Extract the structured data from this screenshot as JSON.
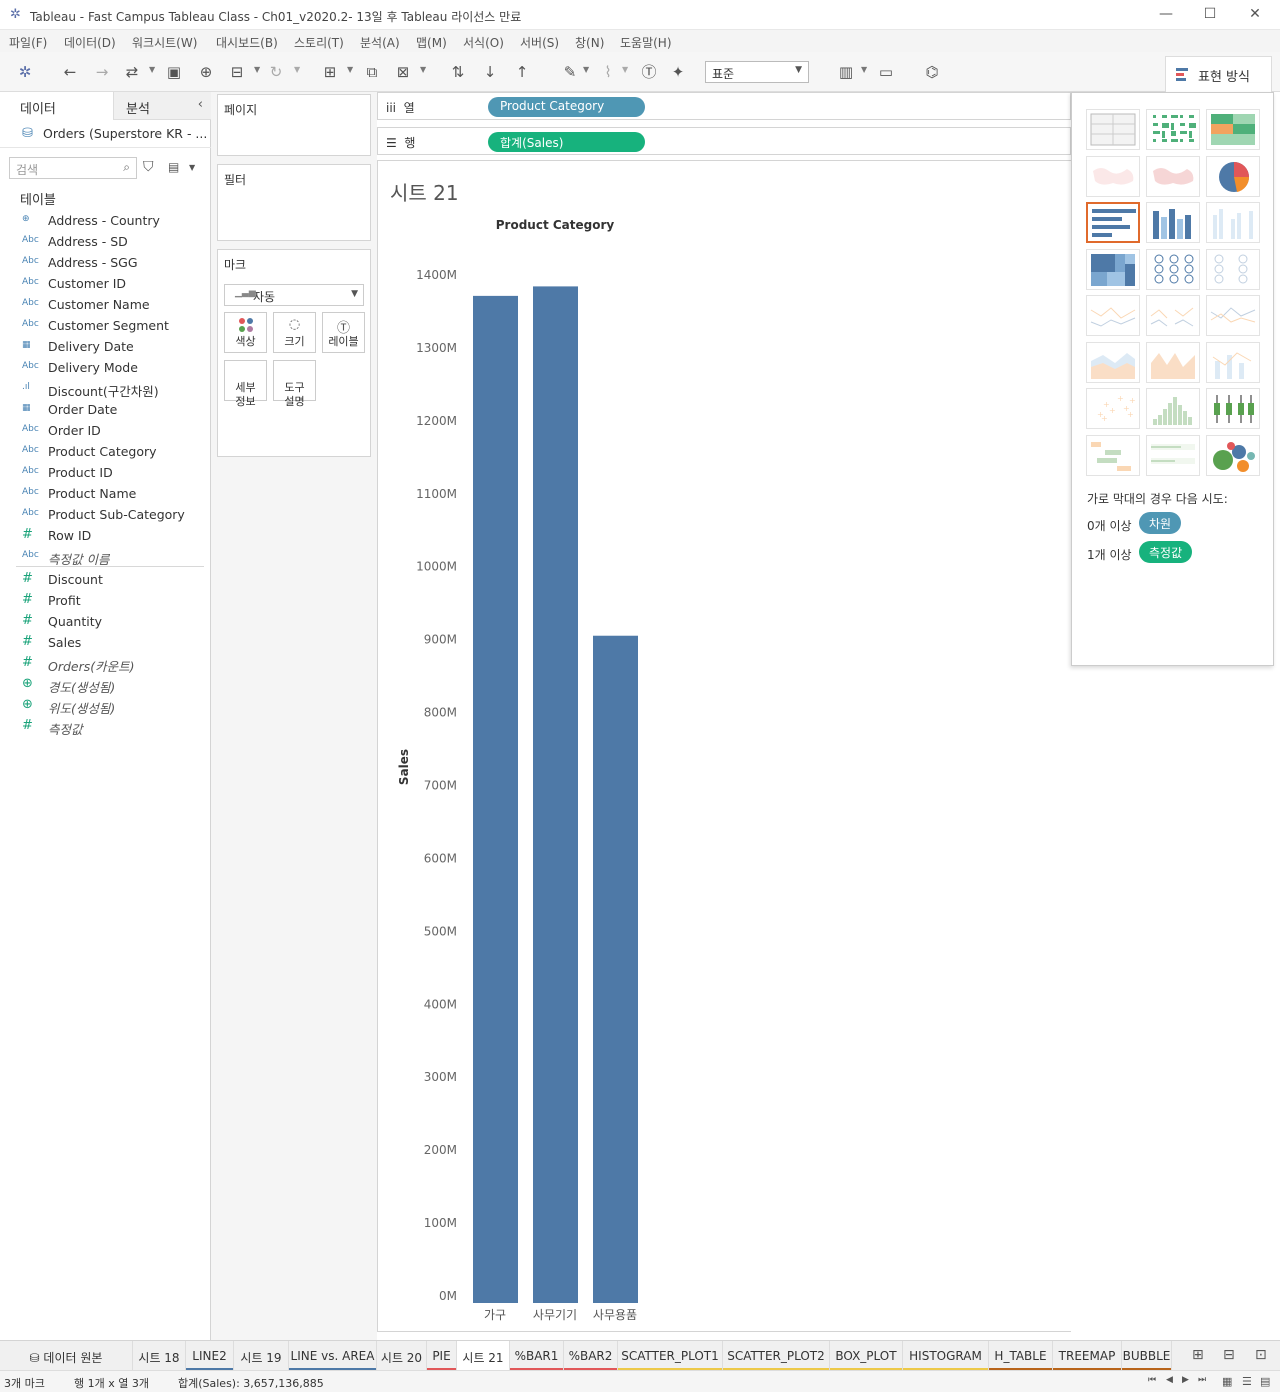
{
  "window": {
    "title": "Tableau - Fast Campus Tableau Class - Ch01_v2020.2- 13일 후 Tableau 라이선스 만료"
  },
  "menu": [
    "파일(F)",
    "데이터(D)",
    "워크시트(W)",
    "대시보드(B)",
    "스토리(T)",
    "분석(A)",
    "맵(M)",
    "서식(O)",
    "서버(S)",
    "창(N)",
    "도움말(H)"
  ],
  "toolbar": {
    "zoom_value": "표준",
    "show_me_label": "표현 방식"
  },
  "left_pane": {
    "tab_data": "데이터",
    "tab_analysis": "분석",
    "datasource": "Orders (Superstore KR - ...",
    "search_placeholder": "검색",
    "tables_header": "테이블",
    "dimensions": [
      {
        "icon": "globe",
        "name": "Address - Country"
      },
      {
        "icon": "Abc",
        "name": "Address - SD"
      },
      {
        "icon": "Abc",
        "name": "Address - SGG"
      },
      {
        "icon": "Abc",
        "name": "Customer ID"
      },
      {
        "icon": "Abc",
        "name": "Customer Name"
      },
      {
        "icon": "Abc",
        "name": "Customer Segment"
      },
      {
        "icon": "calendar",
        "name": "Delivery Date"
      },
      {
        "icon": "Abc",
        "name": "Delivery Mode"
      },
      {
        "icon": "bins",
        "name": "Discount(구간차원)"
      },
      {
        "icon": "calendar",
        "name": "Order Date"
      },
      {
        "icon": "Abc",
        "name": "Order ID"
      },
      {
        "icon": "Abc",
        "name": "Product Category"
      },
      {
        "icon": "Abc",
        "name": "Product ID"
      },
      {
        "icon": "Abc",
        "name": "Product Name"
      },
      {
        "icon": "Abc",
        "name": "Product Sub-Category"
      },
      {
        "icon": "#",
        "name": "Row ID"
      },
      {
        "icon": "Abc",
        "name": "측정값 이름",
        "italic": true
      }
    ],
    "measures": [
      {
        "icon": "#",
        "name": "Discount"
      },
      {
        "icon": "#",
        "name": "Profit"
      },
      {
        "icon": "#",
        "name": "Quantity"
      },
      {
        "icon": "#",
        "name": "Sales"
      },
      {
        "icon": "#",
        "name": "Orders(카운트)",
        "italic": true
      },
      {
        "icon": "globe",
        "name": "경도(생성됨)",
        "italic": true
      },
      {
        "icon": "globe",
        "name": "위도(생성됨)",
        "italic": true
      },
      {
        "icon": "#",
        "name": "측정값",
        "italic": true
      }
    ]
  },
  "cards": {
    "pages": "페이지",
    "filters": "필터",
    "marks": "마크",
    "mark_type": "자동",
    "mark_buttons": {
      "color": "색상",
      "size": "크기",
      "label": "레이블",
      "detail": "세부\n정보",
      "tooltip": "도구\n설명"
    }
  },
  "shelves": {
    "columns_label": "열",
    "rows_label": "행",
    "columns_pill": "Product Category",
    "rows_pill": "합계(Sales)"
  },
  "sheet": {
    "title": "시트 21"
  },
  "chart_data": {
    "type": "bar",
    "title": "Product Category",
    "ylabel": "Sales",
    "categories": [
      "가구",
      "사무기기",
      "사무용품"
    ],
    "values": [
      1370,
      1383,
      904
    ],
    "unit_suffix": "M",
    "ylim": [
      0,
      1400
    ],
    "yticks": [
      0,
      100,
      200,
      300,
      400,
      500,
      600,
      700,
      800,
      900,
      1000,
      1100,
      1200,
      1300,
      1400
    ],
    "bar_color": "#4e79a7"
  },
  "show_me": {
    "hint": "가로 막대의 경우 다음 시도:",
    "dim_count": "0개 이상",
    "dim_badge": "차원",
    "meas_count": "1개 이상",
    "meas_badge": "측정값"
  },
  "sheet_tabs": [
    {
      "label": "데이터 원본",
      "color": ""
    },
    {
      "label": "시트 18",
      "color": ""
    },
    {
      "label": "LINE2",
      "color": "#4e79a7"
    },
    {
      "label": "시트 19",
      "color": ""
    },
    {
      "label": "LINE vs. AREA",
      "color": "#4e79a7"
    },
    {
      "label": "시트 20",
      "color": ""
    },
    {
      "label": "PIE",
      "color": "#e15759"
    },
    {
      "label": "시트 21",
      "color": "",
      "active": true
    },
    {
      "label": "%BAR1",
      "color": "#e15759"
    },
    {
      "label": "%BAR2",
      "color": "#e15759"
    },
    {
      "label": "SCATTER_PLOT1",
      "color": "#edc948"
    },
    {
      "label": "SCATTER_PLOT2",
      "color": "#edc948"
    },
    {
      "label": "BOX_PLOT",
      "color": "#edc948"
    },
    {
      "label": "HISTOGRAM",
      "color": "#edc948"
    },
    {
      "label": "H_TABLE",
      "color": "#b8641a"
    },
    {
      "label": "TREEMAP",
      "color": "#b8641a"
    },
    {
      "label": "BUBBLE",
      "color": "#b8641a"
    }
  ],
  "status": {
    "marks": "3개 마크",
    "rows_cols": "행 1개 x 열 3개",
    "sum": "합계(Sales): 3,657,136,885"
  }
}
